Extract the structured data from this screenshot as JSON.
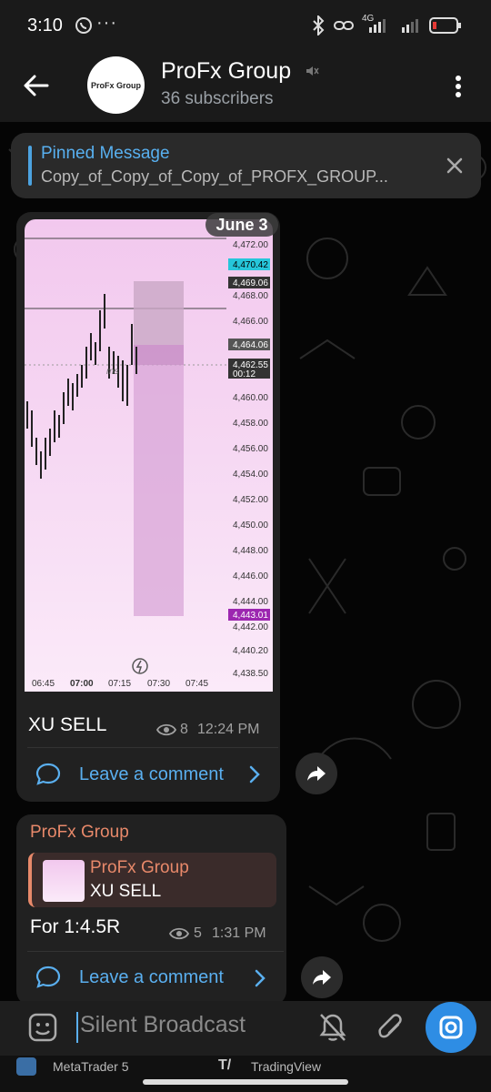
{
  "status": {
    "time": "3:10",
    "dots": "···",
    "network": "4G"
  },
  "header": {
    "title": "ProFx Group",
    "subtitle": "36 subscribers",
    "avatar_text": "ProFx Group"
  },
  "pinned": {
    "label": "Pinned Message",
    "text": "Copy_of_Copy_of_Copy_of_PROFX_GROUP..."
  },
  "date_pill": "June 3",
  "chart_prices": [
    "4,472.00",
    "4,470.42",
    "4,469.06",
    "4,468.00",
    "4,466.00",
    "4,464.06",
    "4,462.55",
    "00:12",
    "4,460.00",
    "4,458.00",
    "4,456.00",
    "4,454.00",
    "4,452.00",
    "4,450.00",
    "4,448.00",
    "4,446.00",
    "4,444.00",
    "4,443.01",
    "4,442.00",
    "4,440.20",
    "4,438.50"
  ],
  "chart_times": [
    "06:45",
    "07:00",
    "07:15",
    "07:30",
    "07:45"
  ],
  "chart_watermark": "ms",
  "message1": {
    "text": "XU SELL",
    "views": "8",
    "time": "12:24 PM",
    "comment": "Leave a comment"
  },
  "message2": {
    "sender": "ProFx Group",
    "quote_sender": "ProFx Group",
    "quote_text": "XU SELL",
    "text": "For 1:4.5R",
    "views": "5",
    "time": "1:31 PM",
    "comment": "Leave a comment"
  },
  "input": {
    "placeholder": "Silent Broadcast"
  },
  "taskbar": {
    "app1": "MetaTrader 5",
    "app2": "TradingView"
  },
  "colors": {
    "accent": "#2e8de4",
    "link": "#5aafef",
    "sender": "#e8896a",
    "chart_bg": "#f2c8ee"
  }
}
